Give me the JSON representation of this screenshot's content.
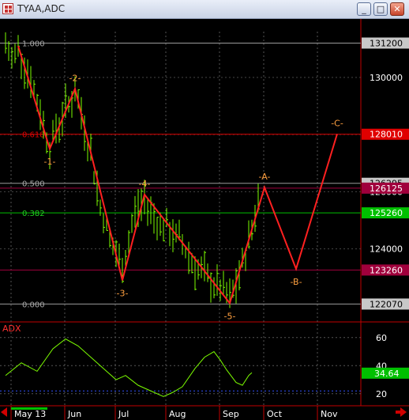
{
  "window": {
    "title": "TYAA,ADC",
    "minimize_label": "_",
    "maximize_label": "□",
    "close_label": "✕"
  },
  "colors": {
    "background": "#000000",
    "price_bars": "#7cfc00",
    "wave_line": "#ff2020",
    "fib_line": "#9a9a9a",
    "label_orange": "#ffa040",
    "adx_line": "#7cfc00",
    "adx_label": "#ff3030"
  },
  "price_axis": {
    "ticks": [
      "130000",
      "128000",
      "126000",
      "124000"
    ],
    "min": 121500,
    "max": 131600,
    "tags": [
      {
        "value": 131200,
        "label": "131200",
        "bg": "#c8c8c8",
        "fg": "#000000"
      },
      {
        "value": 128010,
        "label": "128010",
        "bg": "#e00000",
        "fg": "#ffffff"
      },
      {
        "value": 126295,
        "label": "126295",
        "bg": "#c8c8c8",
        "fg": "#000000"
      },
      {
        "value": 126125,
        "label": "126125",
        "bg": "#a0003c",
        "fg": "#ffffff"
      },
      {
        "value": 125260,
        "label": "125260",
        "bg": "#00c000",
        "fg": "#ffffff"
      },
      {
        "value": 123260,
        "label": "123260",
        "bg": "#a0003c",
        "fg": "#ffffff"
      },
      {
        "value": 122070,
        "label": "122070",
        "bg": "#c8c8c8",
        "fg": "#000000"
      }
    ]
  },
  "fib_levels": [
    {
      "ratio": "1.000",
      "value": 131200,
      "color": "#9a9a9a"
    },
    {
      "ratio": "0.618",
      "value": 128010,
      "color": "#e00000"
    },
    {
      "ratio": "0.500",
      "value": 126295,
      "color": "#9a9a9a"
    },
    {
      "ratio": "0.382",
      "value": 125260,
      "color": "#00c000"
    },
    {
      "ratio": "0.000",
      "value": 122070,
      "color": "#9a9a9a"
    }
  ],
  "extra_levels": [
    {
      "value": 126125,
      "color": "#a0003c"
    },
    {
      "value": 123260,
      "color": "#a0003c"
    }
  ],
  "waves": [
    {
      "label": "-1-",
      "date_index": 14,
      "value": 127500,
      "text_offset": 1
    },
    {
      "label": "-2-",
      "date_index": 22,
      "value": 129600,
      "text_offset": -1
    },
    {
      "label": "-3-",
      "date_index": 37,
      "value": 122900,
      "text_offset": 1
    },
    {
      "label": "-4-",
      "date_index": 44,
      "value": 125900,
      "text_offset": -1
    },
    {
      "label": "-5-",
      "date_index": 71,
      "value": 122100,
      "text_offset": 1
    },
    {
      "label": "-A-",
      "date_index": 82,
      "value": 126150,
      "text_offset": -1
    },
    {
      "label": "-B-",
      "date_index": 92,
      "value": 123300,
      "text_offset": 1
    },
    {
      "label": "-C-",
      "date_index": 105,
      "value": 128020,
      "text_offset": -1
    }
  ],
  "months": [
    {
      "label": "May 13",
      "date_index": 3
    },
    {
      "label": "Jun",
      "date_index": 20
    },
    {
      "label": "Jul",
      "date_index": 36
    },
    {
      "label": "Aug",
      "date_index": 52
    },
    {
      "label": "Sep",
      "date_index": 69
    },
    {
      "label": "Oct",
      "date_index": 83
    },
    {
      "label": "Nov",
      "date_index": 100
    }
  ],
  "adx": {
    "label": "ADX",
    "ticks": [
      "60",
      "40",
      "20"
    ],
    "current_value": "34.64",
    "min": 12,
    "max": 70
  }
}
